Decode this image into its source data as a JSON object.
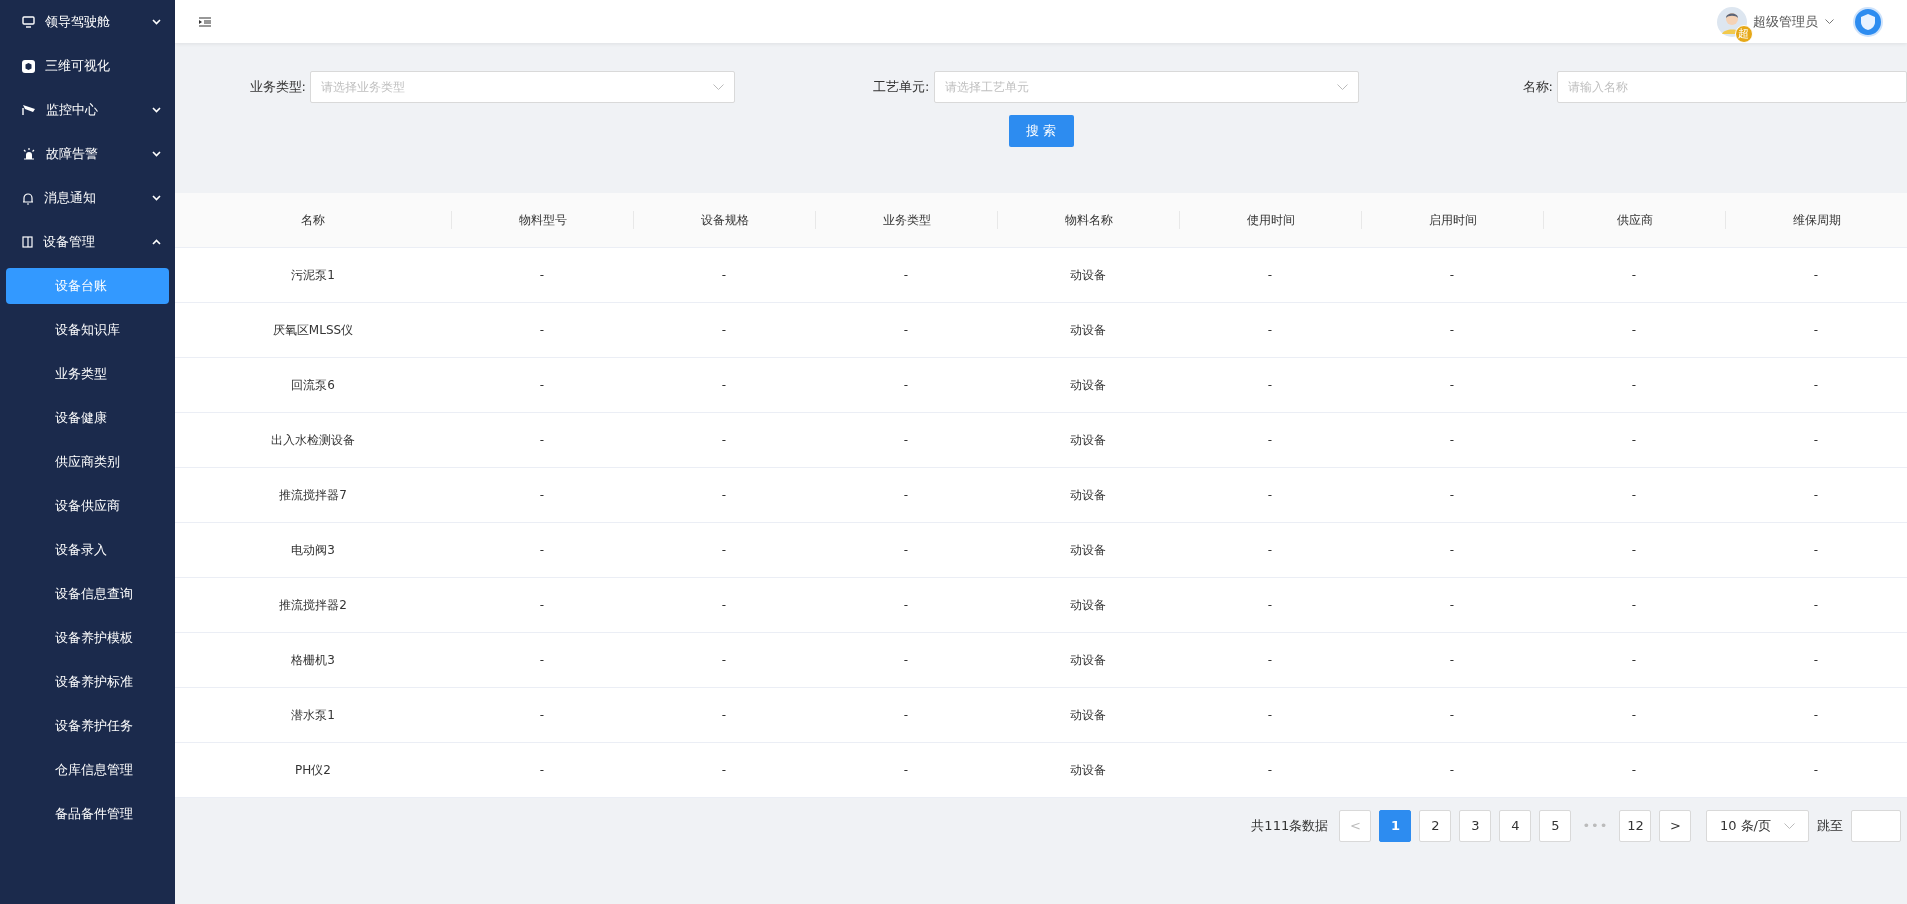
{
  "sidebar": {
    "items": [
      {
        "label": "领导驾驶舱",
        "expanded": false
      },
      {
        "label": "三维可视化"
      },
      {
        "label": "监控中心",
        "expanded": false
      },
      {
        "label": "故障告警",
        "expanded": false
      },
      {
        "label": "消息通知",
        "expanded": false
      },
      {
        "label": "设备管理",
        "expanded": true,
        "children": [
          {
            "label": "设备台账",
            "selected": true
          },
          {
            "label": "设备知识库",
            "selected": false
          },
          {
            "label": "业务类型",
            "selected": false
          },
          {
            "label": "设备健康",
            "selected": false
          },
          {
            "label": "供应商类别",
            "selected": false
          },
          {
            "label": "设备供应商",
            "selected": false
          },
          {
            "label": "设备录入",
            "selected": false
          },
          {
            "label": "设备信息查询",
            "selected": false
          },
          {
            "label": "设备养护模板",
            "selected": false
          },
          {
            "label": "设备养护标准",
            "selected": false
          },
          {
            "label": "设备养护任务",
            "selected": false
          },
          {
            "label": "仓库信息管理",
            "selected": false
          },
          {
            "label": "备品备件管理",
            "selected": false
          }
        ]
      }
    ]
  },
  "header": {
    "user": {
      "name": "超级管理员",
      "badge": "超"
    }
  },
  "filters": [
    {
      "label": "业务类型:",
      "placeholder": "请选择业务类型",
      "kind": "select"
    },
    {
      "label": "工艺单元:",
      "placeholder": "请选择工艺单元",
      "kind": "select"
    },
    {
      "label": "名称:",
      "placeholder": "请输入名称",
      "kind": "input"
    }
  ],
  "search_button": "搜 索",
  "table": {
    "columns": [
      "名称",
      "物料型号",
      "设备规格",
      "业务类型",
      "物料名称",
      "使用时间",
      "启用时间",
      "供应商",
      "维保周期"
    ],
    "rows": [
      [
        "污泥泵1",
        "-",
        "-",
        "-",
        "动设备",
        "-",
        "-",
        "-",
        "-"
      ],
      [
        "厌氧区MLSS仪",
        "-",
        "-",
        "-",
        "动设备",
        "-",
        "-",
        "-",
        "-"
      ],
      [
        "回流泵6",
        "-",
        "-",
        "-",
        "动设备",
        "-",
        "-",
        "-",
        "-"
      ],
      [
        "出入水检测设备",
        "-",
        "-",
        "-",
        "动设备",
        "-",
        "-",
        "-",
        "-"
      ],
      [
        "推流搅拌器7",
        "-",
        "-",
        "-",
        "动设备",
        "-",
        "-",
        "-",
        "-"
      ],
      [
        "电动阀3",
        "-",
        "-",
        "-",
        "动设备",
        "-",
        "-",
        "-",
        "-"
      ],
      [
        "推流搅拌器2",
        "-",
        "-",
        "-",
        "动设备",
        "-",
        "-",
        "-",
        "-"
      ],
      [
        "格栅机3",
        "-",
        "-",
        "-",
        "动设备",
        "-",
        "-",
        "-",
        "-"
      ],
      [
        "潜水泵1",
        "-",
        "-",
        "-",
        "动设备",
        "-",
        "-",
        "-",
        "-"
      ],
      [
        "PH仪2",
        "-",
        "-",
        "-",
        "动设备",
        "-",
        "-",
        "-",
        "-"
      ]
    ]
  },
  "pagination": {
    "total": "共111条数据",
    "prev": "<",
    "pages": [
      {
        "label": "1",
        "selected": true
      },
      {
        "label": "2",
        "selected": false
      },
      {
        "label": "3",
        "selected": false
      },
      {
        "label": "4",
        "selected": false
      },
      {
        "label": "5",
        "selected": false
      },
      {
        "label": "•••",
        "kind": "ellipsis"
      },
      {
        "label": "12",
        "selected": false
      }
    ],
    "next": ">",
    "page_size": "10 条/页",
    "jump_label": "跳至"
  }
}
